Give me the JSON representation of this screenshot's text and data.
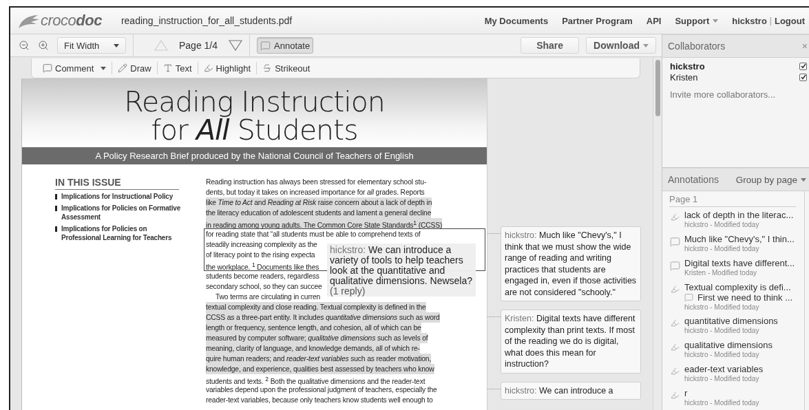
{
  "header": {
    "logo": "croco**doc**",
    "filename": "reading_instruction_for_all_students.pdf",
    "nav": [
      {
        "label": "My Documents",
        "has_menu": false
      },
      {
        "label": "Partner Program",
        "has_menu": false
      },
      {
        "label": "API",
        "has_menu": false
      },
      {
        "label": "Support",
        "has_menu": true
      }
    ],
    "user": "hickstro",
    "separator": "|",
    "logout": "Logout"
  },
  "toolbar": {
    "zoom": "Fit Width",
    "page_up_disabled": true,
    "page": "Page 1/4",
    "page_down_disabled": false,
    "annotate": {
      "label": "Annotate",
      "selected": true
    },
    "share": "Share",
    "download": "Download"
  },
  "annotation_tools": [
    {
      "kind": "comment",
      "label": "Comment",
      "has_menu": true
    },
    {
      "kind": "draw",
      "label": "Draw",
      "has_menu": false
    },
    {
      "kind": "text",
      "label": "Text",
      "has_menu": false
    },
    {
      "kind": "highlight",
      "label": "Highlight",
      "has_menu": false
    },
    {
      "kind": "strikeout",
      "label": "Strikeout",
      "has_menu": false
    }
  ],
  "document": {
    "title_lines": [
      "Reading Instruction",
      "for *All* Students"
    ],
    "banner": "A Policy Research Brief produced by the National Council of Teachers of English",
    "issue_heading": "IN THIS ISSUE",
    "issue_items": [
      "Implications for Instructional Policy",
      "Implications for Policies on Formative Assessment",
      "Implications for Policies on Professional Learning for Teachers"
    ],
    "lines": [
      {
        "text": "Reading instruction has always been stressed for elementary school stu-",
        "highlighted": false,
        "boxed": false,
        "indent": false
      },
      {
        "text": "dents, but today it takes on increased importance for *all* grades.  Reports",
        "highlighted": false,
        "boxed": false,
        "indent": false
      },
      {
        "text": "like *Time to Act*  and *Reading at Risk* raise concern about a lack of  depth in",
        "highlighted": true,
        "boxed": false,
        "indent": false
      },
      {
        "text": "the literacy education of adolescent students and lament a general decline",
        "highlighted": true,
        "boxed": false,
        "indent": false
      },
      {
        "text": "in reading among young adults. The Common Core State Standards$^{1}$ (CCSS)",
        "highlighted": true,
        "boxed": false,
        "indent": false
      },
      {
        "text": "for reading state that “all students must be able to comprehend texts of",
        "highlighted": false,
        "boxed": true,
        "indent": false
      },
      {
        "text": "steadily increasing complexity as the",
        "highlighted": false,
        "boxed": true,
        "indent": false
      },
      {
        "text": "of literacy point to the rising expecta",
        "highlighted": false,
        "boxed": true,
        "indent": false
      },
      {
        "text": "the workplace. $^{1}$ Documents like thes",
        "highlighted": false,
        "boxed": true,
        "indent": false
      },
      {
        "text": "students become readers, regardless",
        "highlighted": false,
        "boxed": false,
        "indent": false
      },
      {
        "text": "secondary school, so they can succee",
        "highlighted": false,
        "boxed": false,
        "indent": false
      },
      {
        "text": "Two terms are circulating in curren",
        "highlighted": false,
        "boxed": false,
        "indent": true
      },
      {
        "text": "textual complexity and close reading. Textual complexity is defined in the",
        "highlighted": true,
        "boxed": false,
        "indent": false
      },
      {
        "text": "CCSS as a three-part entity. It includes *quantitative dimensions* such as word",
        "highlighted": true,
        "boxed": false,
        "indent": false
      },
      {
        "text": "length or frequency, sentence length, and cohesion, all of which can be",
        "highlighted": true,
        "boxed": false,
        "indent": false
      },
      {
        "text": "measured by computer software; *qualitative dimensions* such as levels of",
        "highlighted": true,
        "boxed": false,
        "indent": false
      },
      {
        "text": "meaning, clarity of language, and knowledge demands, all of which re-",
        "highlighted": true,
        "boxed": false,
        "indent": false
      },
      {
        "text": "quire human readers; and *reader-text variables* such as reader motivation,",
        "highlighted": true,
        "boxed": false,
        "indent": false
      },
      {
        "text": "knowledge, and experience, qualities best assessed by teachers who know",
        "highlighted": true,
        "boxed": false,
        "indent": false
      },
      {
        "text": "students and texts. $^{2}$ Both the qualitative dimensions and the reader-text",
        "highlighted": false,
        "boxed": false,
        "indent": false
      },
      {
        "text": "variables depend upon the professional judgment of teachers, especially the",
        "highlighted": false,
        "boxed": false,
        "indent": false
      },
      {
        "text": "reader-text variables, because only teachers know students well enough to",
        "highlighted": false,
        "boxed": false,
        "indent": false
      }
    ],
    "popup_comment": {
      "author": "hickstro:",
      "text": "We can introduce a variety of tools to help teachers look at the quantitative and qualitative dimensions. Newsela?",
      "replies": "(1 reply)"
    }
  },
  "comments": [
    {
      "author": "hickstro:",
      "text": "Much like \"Chevy's,\" I think that we must show the wide range of reading and writing practices that students are engaged in, even if those activities are not considered \"schooly.\""
    },
    {
      "author": "Kristen:",
      "text": "Digital texts have different complexity than print texts.  If most of the reading we do is digital, what does this mean for instruction?"
    },
    {
      "author": "hickstro:",
      "text": "We can introduce a"
    }
  ],
  "sidebar": {
    "collaborators_title": "Collaborators",
    "close": "×",
    "collaborators": [
      {
        "name": "hickstro",
        "is_you": true,
        "checked": true
      },
      {
        "name": "Kristen",
        "is_you": false,
        "checked": true
      }
    ],
    "invite": "Invite more collaborators...",
    "annotations_title": "Annotations",
    "group_by": "Group by page",
    "page_heading": "Page 1",
    "annotations": [
      {
        "kind": "highlight",
        "title": "lack of depth in the literac...",
        "meta": "hickstro - Modified today"
      },
      {
        "kind": "comment",
        "title": "Much like \"Chevy's,\" I thin...",
        "meta": "hickstro - Modified today"
      },
      {
        "kind": "comment",
        "title": "Digital texts have different...",
        "meta": "Kristen - Modified today"
      },
      {
        "kind": "highlight",
        "title": "Textual complexity is defi...",
        "reply": "First we need to think ...",
        "meta": "hickstro - Modified today"
      },
      {
        "kind": "highlight",
        "title": "quantitative dimensions",
        "meta": "hickstro - Modified today"
      },
      {
        "kind": "highlight",
        "title": "qualitative dimensions",
        "meta": "hickstro - Modified today"
      },
      {
        "kind": "highlight",
        "title": "eader-text variables",
        "meta": "hickstro - Modified today"
      },
      {
        "kind": "highlight",
        "title": "r",
        "meta": "hickstro - Modified today"
      }
    ]
  }
}
